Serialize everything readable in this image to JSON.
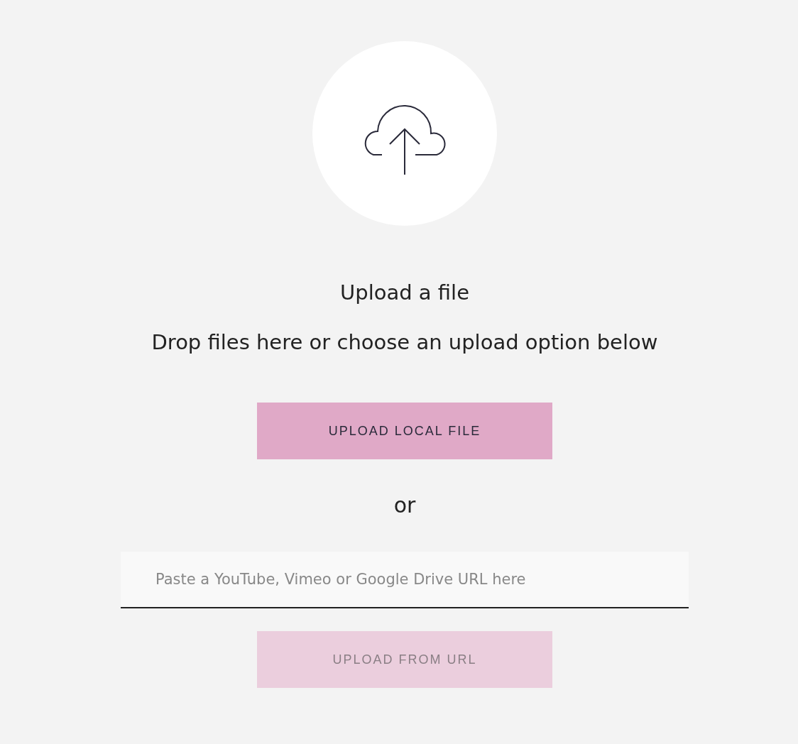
{
  "title": "Upload a file",
  "subtitle": "Drop files here or choose an upload option below",
  "local_button": {
    "label": "UPLOAD LOCAL FILE",
    "disabled": false
  },
  "separator": "or",
  "url_field": {
    "placeholder": "Paste a YouTube, Vimeo or Google Drive URL here"
  },
  "url_button": {
    "label": "UPLOAD FROM URL",
    "disabled": true
  }
}
